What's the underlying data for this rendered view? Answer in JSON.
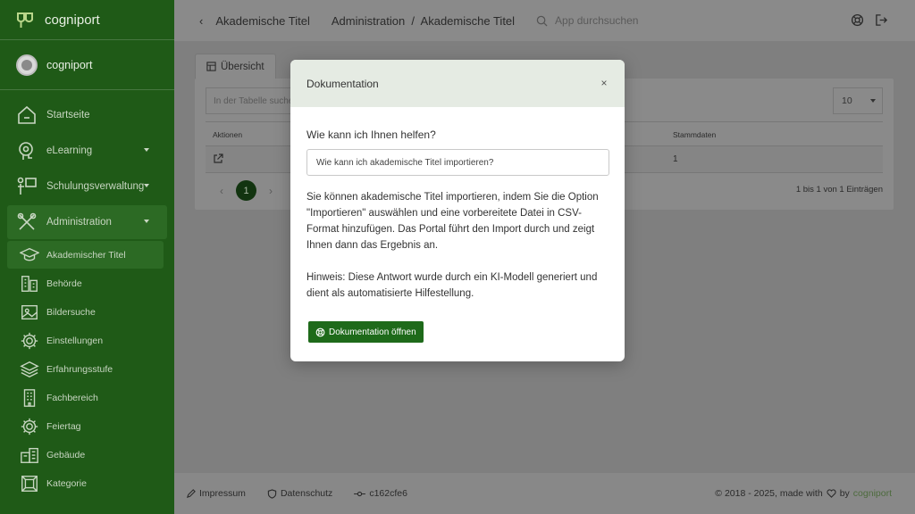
{
  "brand": {
    "name": "cogniport"
  },
  "user": {
    "name": "cogniport"
  },
  "nav": [
    {
      "label": "Startseite",
      "icon": "home-icon",
      "expandable": false
    },
    {
      "label": "eLearning",
      "icon": "lightbulb-head-icon",
      "expandable": true
    },
    {
      "label": "Schulungsverwaltung",
      "icon": "presenter-icon",
      "expandable": true
    },
    {
      "label": "Administration",
      "icon": "tools-icon",
      "expandable": true,
      "active": true
    }
  ],
  "subnav": [
    {
      "label": "Akademischer Titel",
      "icon": "graduation-cap-icon",
      "active": true
    },
    {
      "label": "Behörde",
      "icon": "building-icon"
    },
    {
      "label": "Bildersuche",
      "icon": "image-icon"
    },
    {
      "label": "Einstellungen",
      "icon": "gear-icon"
    },
    {
      "label": "Erfahrungsstufe",
      "icon": "layers-icon"
    },
    {
      "label": "Fachbereich",
      "icon": "office-building-icon"
    },
    {
      "label": "Feiertag",
      "icon": "gear-icon"
    },
    {
      "label": "Gebäude",
      "icon": "buildings-icon"
    },
    {
      "label": "Kategorie",
      "icon": "frame-icon"
    }
  ],
  "topbar": {
    "back": "‹",
    "title": "Akademische Titel",
    "breadcrumb": "Administration  /  Akademische Titel",
    "search_placeholder": "App durchsuchen"
  },
  "content": {
    "tab_label": "Übersicht",
    "table_search_placeholder": "In der Tabelle suchen",
    "page_size": "10",
    "columns": [
      "Aktionen",
      "Stammdaten"
    ],
    "rows": [
      {
        "stammdaten": "1"
      }
    ],
    "current_page": "1",
    "range": "1 bis 1 von 1 Einträgen"
  },
  "footer": {
    "impressum": "Impressum",
    "datenschutz": "Datenschutz",
    "commit": "c162cfe6",
    "copyright": "© 2018 - 2025, made with",
    "by": "by",
    "brandword": "cogniport"
  },
  "modal": {
    "title": "Dokumentation",
    "question_label": "Wie kann ich Ihnen helfen?",
    "question_value": "Wie kann ich akademische Titel importieren?",
    "answer_1": "Sie können akademische Titel importieren, indem Sie die Option \"Importieren\" auswählen und eine vorbereitete Datei in CSV-Format hinzufügen. Das Portal führt den Import durch und zeigt Ihnen dann das Ergebnis an.",
    "answer_2": "Hinweis: Diese Antwort wurde durch ein KI-Modell generiert und dient als automatisierte Hilfestellung.",
    "button_label": "Dokumentation öffnen",
    "close": "×"
  }
}
